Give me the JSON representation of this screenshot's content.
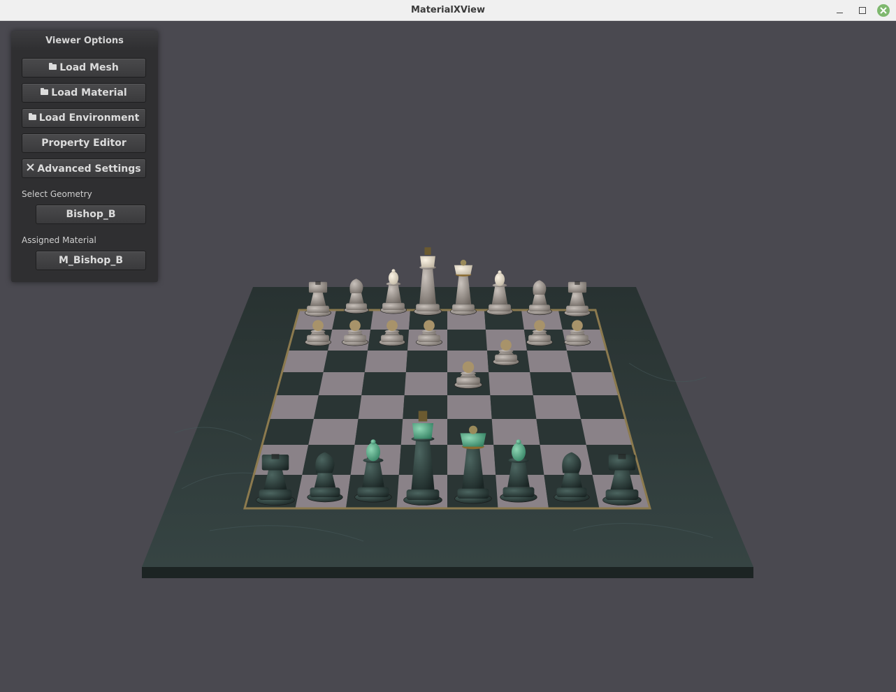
{
  "window": {
    "title": "MaterialXView"
  },
  "panel": {
    "header": "Viewer Options",
    "buttons": {
      "load_mesh": "Load Mesh",
      "load_material": "Load Material",
      "load_environment": "Load Environment",
      "property_editor": "Property Editor",
      "advanced_settings": "Advanced Settings"
    },
    "select_geometry": {
      "label": "Select Geometry",
      "value": "Bishop_B"
    },
    "assigned_material": {
      "label": "Assigned Material",
      "value": "M_Bishop_B"
    }
  },
  "icons": {
    "load_mesh": "folder-icon",
    "load_material": "folder-icon",
    "load_environment": "folder-icon",
    "advanced_settings": "wrench-cross-icon"
  },
  "colors": {
    "background": "#4a4950",
    "panel": "#2f2f31",
    "board_base": "#2e3b3a",
    "light_square": "#8a8288",
    "dark_square": "#2a3534",
    "white_piece": "#9a948e",
    "black_piece": "#2c3b38",
    "accent_green": "#4fa37f"
  }
}
